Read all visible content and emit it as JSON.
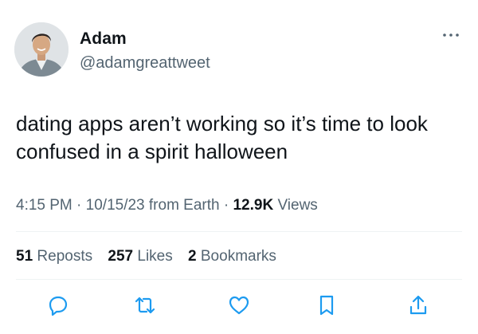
{
  "author": {
    "name": "Adam",
    "handle": "@adamgreattweet",
    "avatar_icon": "profile-photo"
  },
  "tweet": {
    "text_line1": "dating apps aren’t working so it’s time to look",
    "text_line2": "confused in a spirit halloween"
  },
  "meta": {
    "time": "4:15 PM",
    "separator1": " · ",
    "date": "10/15/23 from Earth",
    "separator2": " · ",
    "views_count": "12.9K",
    "views_label": " Views"
  },
  "stats": {
    "reposts_count": "51",
    "reposts_label": " Reposts",
    "likes_count": "257",
    "likes_label": " Likes",
    "bookmarks_count": "2",
    "bookmarks_label": " Bookmarks"
  },
  "actions": [
    "reply-icon",
    "repost-icon",
    "like-icon",
    "bookmark-icon",
    "share-icon"
  ],
  "colors": {
    "text": "#0f1419",
    "secondary": "#536471",
    "icon": "#1d9bf0",
    "divider": "#eff3f4"
  }
}
